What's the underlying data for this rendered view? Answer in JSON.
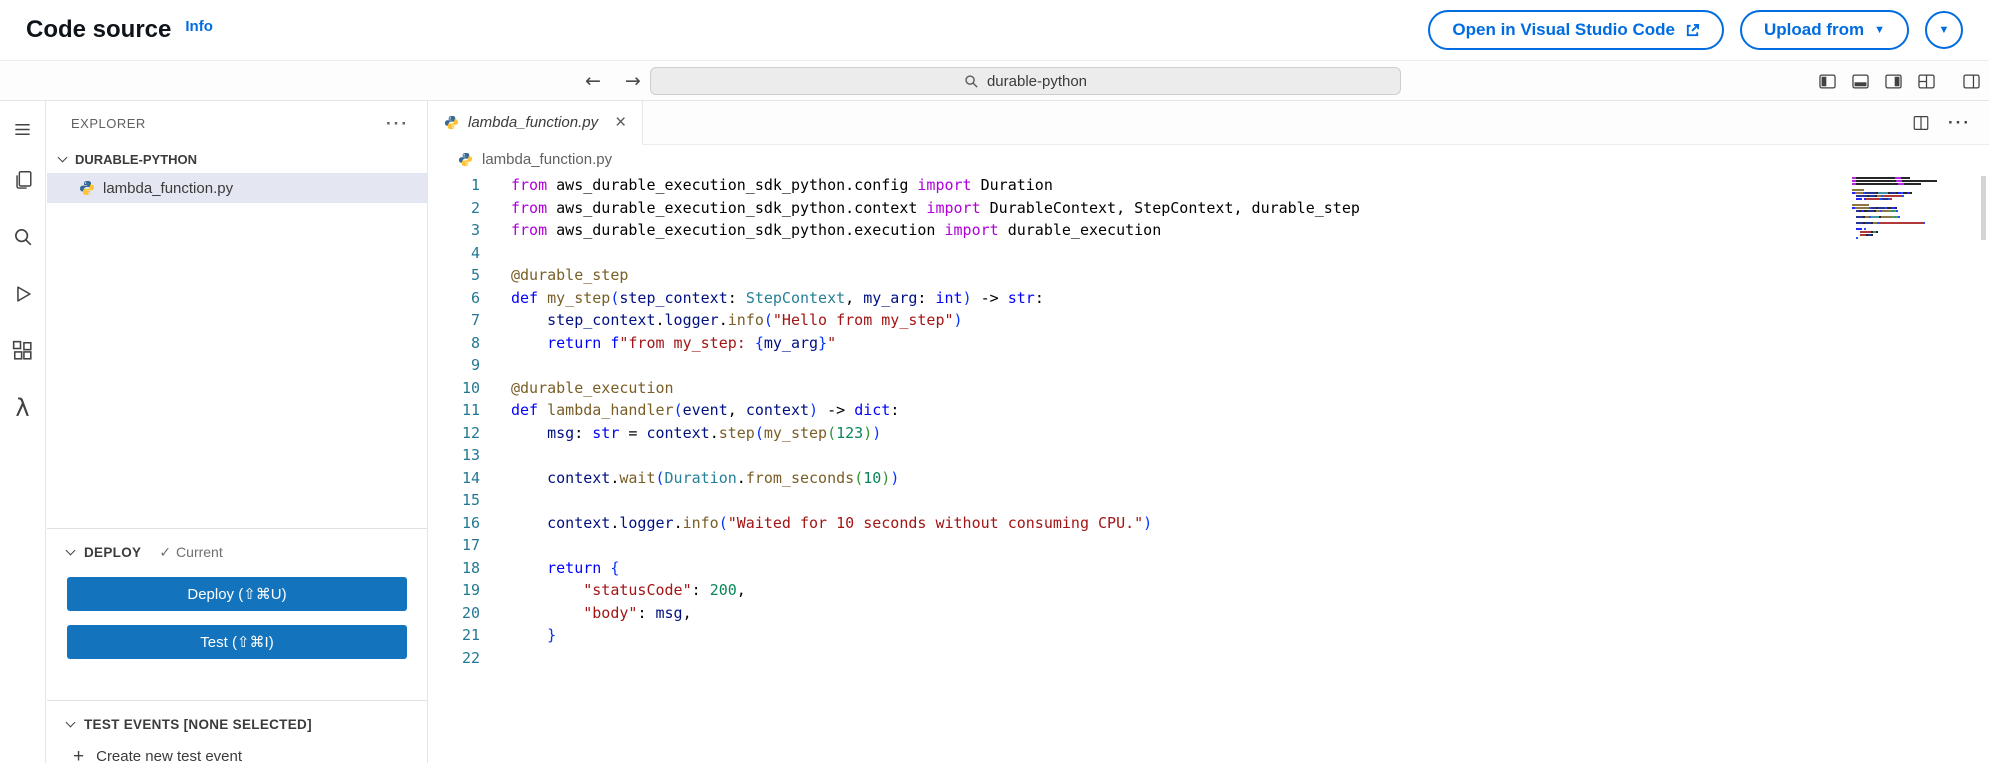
{
  "header": {
    "title": "Code source",
    "info_link": "Info",
    "open_vsc_label": "Open in Visual Studio Code",
    "upload_label": "Upload from"
  },
  "titlebar": {
    "search_value": "durable-python",
    "nav_icons": [
      "back-arrow-icon",
      "forward-arrow-icon"
    ],
    "layout_icons": [
      "toggle-primary-sidebar-icon",
      "toggle-panel-icon",
      "toggle-secondary-sidebar-icon",
      "customize-layout-icon",
      "editor-layout-icon"
    ]
  },
  "activity_bar": {
    "icons": [
      "menu-icon",
      "explorer-icon",
      "search-icon",
      "run-debug-icon",
      "extensions-icon",
      "lambda-icon"
    ]
  },
  "sidebar": {
    "explorer_label": "EXPLORER",
    "folder_name": "DURABLE-PYTHON",
    "files": [
      {
        "name": "lambda_function.py",
        "selected": true
      }
    ],
    "deploy": {
      "label": "DEPLOY",
      "status": "Current",
      "deploy_button": "Deploy (⇧⌘U)",
      "test_button": "Test (⇧⌘I)"
    },
    "test_events": {
      "label": "TEST EVENTS [NONE SELECTED]",
      "create_label": "Create new test event"
    }
  },
  "editor": {
    "tab_title": "lambda_function.py",
    "breadcrumb": "lambda_function.py",
    "language": "python",
    "token_colors": {
      "imp": "#af00db",
      "kw": "#0000ff",
      "fn": "#795e26",
      "var": "#001080",
      "cls": "#267f99",
      "str": "#a31515",
      "num": "#098658",
      "pl": "#000000",
      "br1": "#0431fa",
      "br2": "#319331"
    },
    "code_lines": [
      [
        [
          "imp",
          "from"
        ],
        [
          "pl",
          " aws_durable_execution_sdk_python.config "
        ],
        [
          "imp",
          "import"
        ],
        [
          "pl",
          " Duration"
        ]
      ],
      [
        [
          "imp",
          "from"
        ],
        [
          "pl",
          " aws_durable_execution_sdk_python.context "
        ],
        [
          "imp",
          "import"
        ],
        [
          "pl",
          " DurableContext, StepContext, durable_step"
        ]
      ],
      [
        [
          "imp",
          "from"
        ],
        [
          "pl",
          " aws_durable_execution_sdk_python.execution "
        ],
        [
          "imp",
          "import"
        ],
        [
          "pl",
          " durable_execution"
        ]
      ],
      [],
      [
        [
          "fn",
          "@durable_step"
        ]
      ],
      [
        [
          "kw",
          "def"
        ],
        [
          "fn",
          " my_step"
        ],
        [
          "br1",
          "("
        ],
        [
          "var",
          "step_context"
        ],
        [
          "pl",
          ": "
        ],
        [
          "cls",
          "StepContext"
        ],
        [
          "pl",
          ", "
        ],
        [
          "var",
          "my_arg"
        ],
        [
          "pl",
          ": "
        ],
        [
          "kw",
          "int"
        ],
        [
          "br1",
          ")"
        ],
        [
          "pl",
          " -> "
        ],
        [
          "kw",
          "str"
        ],
        [
          "pl",
          ":"
        ]
      ],
      [
        [
          "pl",
          "    "
        ],
        [
          "var",
          "step_context"
        ],
        [
          "pl",
          "."
        ],
        [
          "var",
          "logger"
        ],
        [
          "pl",
          "."
        ],
        [
          "fn",
          "info"
        ],
        [
          "br1",
          "("
        ],
        [
          "str",
          "\"Hello from my_step\""
        ],
        [
          "br1",
          ")"
        ]
      ],
      [
        [
          "pl",
          "    "
        ],
        [
          "kw",
          "return"
        ],
        [
          "pl",
          " "
        ],
        [
          "kw",
          "f"
        ],
        [
          "str",
          "\"from my_step: "
        ],
        [
          "br1",
          "{"
        ],
        [
          "var",
          "my_arg"
        ],
        [
          "br1",
          "}"
        ],
        [
          "str",
          "\""
        ]
      ],
      [],
      [
        [
          "fn",
          "@durable_execution"
        ]
      ],
      [
        [
          "kw",
          "def"
        ],
        [
          "fn",
          " lambda_handler"
        ],
        [
          "br1",
          "("
        ],
        [
          "var",
          "event"
        ],
        [
          "pl",
          ", "
        ],
        [
          "var",
          "context"
        ],
        [
          "br1",
          ")"
        ],
        [
          "pl",
          " -> "
        ],
        [
          "kw",
          "dict"
        ],
        [
          "pl",
          ":"
        ]
      ],
      [
        [
          "pl",
          "    "
        ],
        [
          "var",
          "msg"
        ],
        [
          "pl",
          ": "
        ],
        [
          "kw",
          "str"
        ],
        [
          "pl",
          " = "
        ],
        [
          "var",
          "context"
        ],
        [
          "pl",
          "."
        ],
        [
          "fn",
          "step"
        ],
        [
          "br1",
          "("
        ],
        [
          "fn",
          "my_step"
        ],
        [
          "br2",
          "("
        ],
        [
          "num",
          "123"
        ],
        [
          "br2",
          ")"
        ],
        [
          "br1",
          ")"
        ]
      ],
      [],
      [
        [
          "pl",
          "    "
        ],
        [
          "var",
          "context"
        ],
        [
          "pl",
          "."
        ],
        [
          "fn",
          "wait"
        ],
        [
          "br1",
          "("
        ],
        [
          "cls",
          "Duration"
        ],
        [
          "pl",
          "."
        ],
        [
          "fn",
          "from_seconds"
        ],
        [
          "br2",
          "("
        ],
        [
          "num",
          "10"
        ],
        [
          "br2",
          ")"
        ],
        [
          "br1",
          ")"
        ]
      ],
      [],
      [
        [
          "pl",
          "    "
        ],
        [
          "var",
          "context"
        ],
        [
          "pl",
          "."
        ],
        [
          "var",
          "logger"
        ],
        [
          "pl",
          "."
        ],
        [
          "fn",
          "info"
        ],
        [
          "br1",
          "("
        ],
        [
          "str",
          "\"Waited for 10 seconds without consuming CPU.\""
        ],
        [
          "br1",
          ")"
        ]
      ],
      [],
      [
        [
          "pl",
          "    "
        ],
        [
          "kw",
          "return"
        ],
        [
          "pl",
          " "
        ],
        [
          "br1",
          "{"
        ]
      ],
      [
        [
          "pl",
          "        "
        ],
        [
          "str",
          "\"statusCode\""
        ],
        [
          "pl",
          ": "
        ],
        [
          "num",
          "200"
        ],
        [
          "pl",
          ","
        ]
      ],
      [
        [
          "pl",
          "        "
        ],
        [
          "str",
          "\"body\""
        ],
        [
          "pl",
          ": "
        ],
        [
          "var",
          "msg"
        ],
        [
          "pl",
          ","
        ]
      ],
      [
        [
          "pl",
          "    "
        ],
        [
          "br1",
          "}"
        ]
      ],
      []
    ]
  },
  "colors": {
    "aws_accent": "#006ce0",
    "button_blue": "#1373bc",
    "selected_file_bg": "#e4e6f1",
    "line_number": "#237893"
  }
}
